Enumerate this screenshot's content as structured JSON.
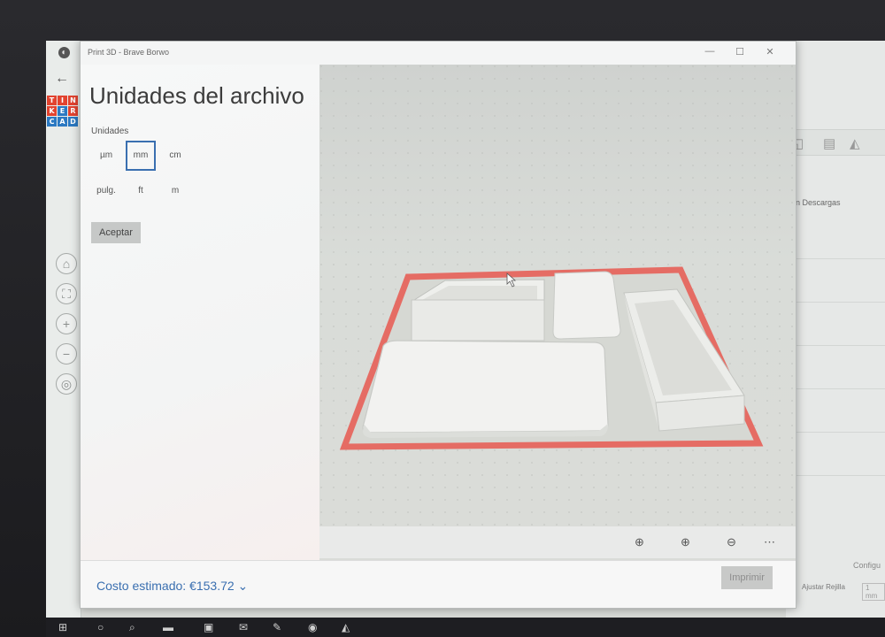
{
  "window": {
    "title": "Print 3D - Brave Borwo",
    "minimize": "—",
    "maximize": "☐",
    "close": "✕"
  },
  "panel": {
    "title": "Unidades del archivo",
    "units_label": "Unidades",
    "units": [
      {
        "label": "µm",
        "selected": false
      },
      {
        "label": "mm",
        "selected": true
      },
      {
        "label": "cm",
        "selected": false
      },
      {
        "label": "pulg.",
        "selected": false
      },
      {
        "label": "ft",
        "selected": false
      },
      {
        "label": "m",
        "selected": false
      }
    ],
    "accept_label": "Aceptar"
  },
  "footer": {
    "cost_text": "Costo estimado: €153.72",
    "cost_chevron": "⌄",
    "print_label": "Imprimir"
  },
  "viewport_toolbar": {
    "icons": [
      "recenter-icon",
      "zoom-in-icon",
      "zoom-out-icon",
      "more-icon"
    ],
    "glyphs": [
      "⊕",
      "⊕",
      "⊖",
      "⋯"
    ]
  },
  "background_app": {
    "logo_letters": [
      "T",
      "I",
      "N",
      "K",
      "E",
      "R",
      "C",
      "A",
      "D"
    ],
    "logo_colors": [
      "#e2432f",
      "#e2432f",
      "#e2432f",
      "#e2432f",
      "#2b79c2",
      "#e2432f",
      "#2b79c2",
      "#2b79c2",
      "#2b79c2"
    ],
    "descargas_text": "en Descargas",
    "config_text": "Configu",
    "ajustar_text": "Ajustar Rejilla",
    "grid_value": "1 mm"
  },
  "colors": {
    "accent": "#3a6fb0",
    "build_plate_border": "#e56c64"
  }
}
